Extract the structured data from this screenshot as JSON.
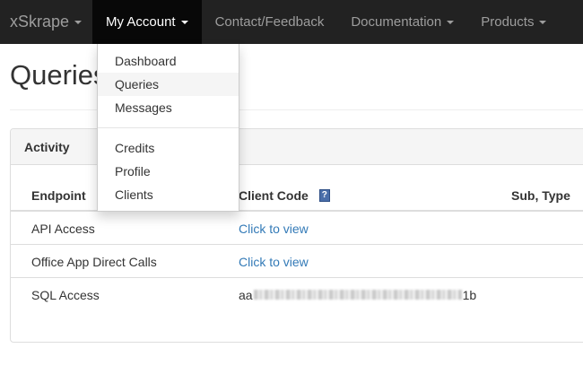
{
  "navbar": {
    "brand": "xSkrape",
    "items": [
      {
        "label": "My Account",
        "active": true
      },
      {
        "label": "Contact/Feedback"
      },
      {
        "label": "Documentation"
      },
      {
        "label": "Products"
      }
    ]
  },
  "dropdown": {
    "items": [
      "Dashboard",
      "Queries",
      "Messages",
      "Credits",
      "Profile",
      "Clients"
    ],
    "highlighted": "Queries"
  },
  "page": {
    "title": "Queries"
  },
  "panel": {
    "heading": "Activity"
  },
  "table": {
    "headers": [
      "Endpoint",
      "Client Code",
      "Sub, Type"
    ],
    "help_icon_glyph": "?",
    "rows": [
      {
        "endpoint": "API Access",
        "client_code": "Click to view"
      },
      {
        "endpoint": "Office App Direct Calls",
        "client_code": "Click to view"
      },
      {
        "endpoint": "SQL Access",
        "client_code_prefix": "aa",
        "client_code_suffix": "1b"
      }
    ]
  },
  "colors": {
    "navbar_bg": "#222222",
    "active_nav_bg": "#080808",
    "link": "#337ab7",
    "panel_heading_bg": "#f5f5f5"
  }
}
